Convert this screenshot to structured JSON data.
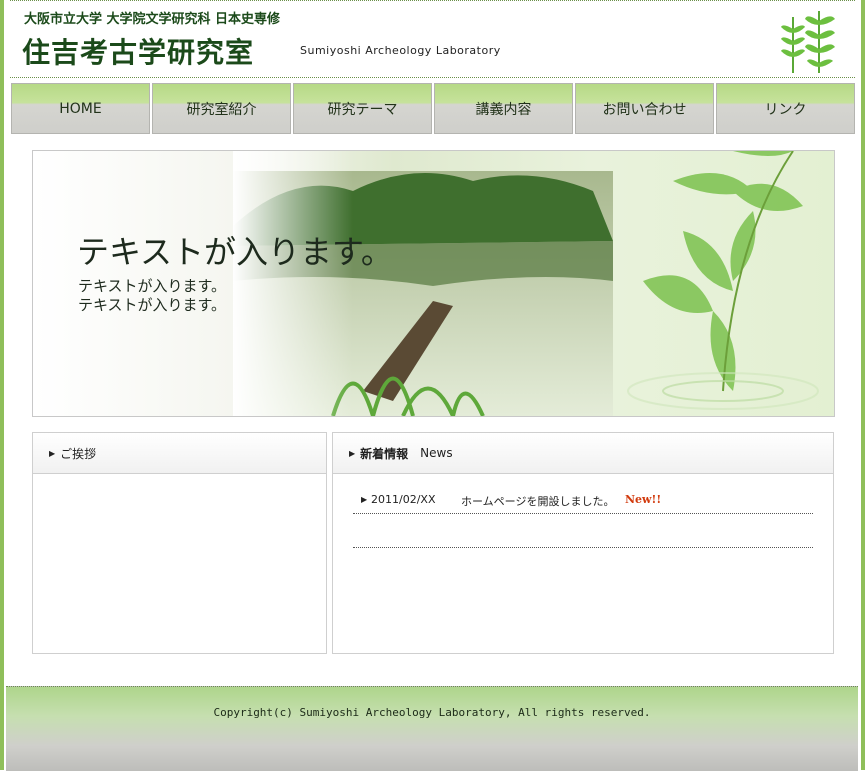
{
  "header": {
    "sub_title": "大阪市立大学 大学院文学研究科 日本史専修",
    "main_title": "住吉考古学研究室",
    "en_title": "Sumiyoshi Archeology Laboratory"
  },
  "nav": {
    "items": [
      {
        "label": "HOME"
      },
      {
        "label": "研究室紹介"
      },
      {
        "label": "研究テーマ"
      },
      {
        "label": "講義内容"
      },
      {
        "label": "お問い合わせ"
      },
      {
        "label": "リンク"
      }
    ]
  },
  "hero": {
    "headline": "テキストが入ります。",
    "line1": "テキストが入ります。",
    "line2": "テキストが入ります。"
  },
  "greeting": {
    "heading": "ご挨拶"
  },
  "news": {
    "heading": "新着情報",
    "heading_en": "News",
    "items": [
      {
        "date": "2011/02/XX",
        "text": "ホームページを開設しました。",
        "badge": "New!!"
      }
    ]
  },
  "footer": {
    "copyright": "Copyright(c) Sumiyoshi Archeology Laboratory, All rights reserved."
  },
  "colors": {
    "brand_green": "#8fbf5a",
    "title_green": "#1b4a1a",
    "new_badge": "#d23a0d"
  }
}
